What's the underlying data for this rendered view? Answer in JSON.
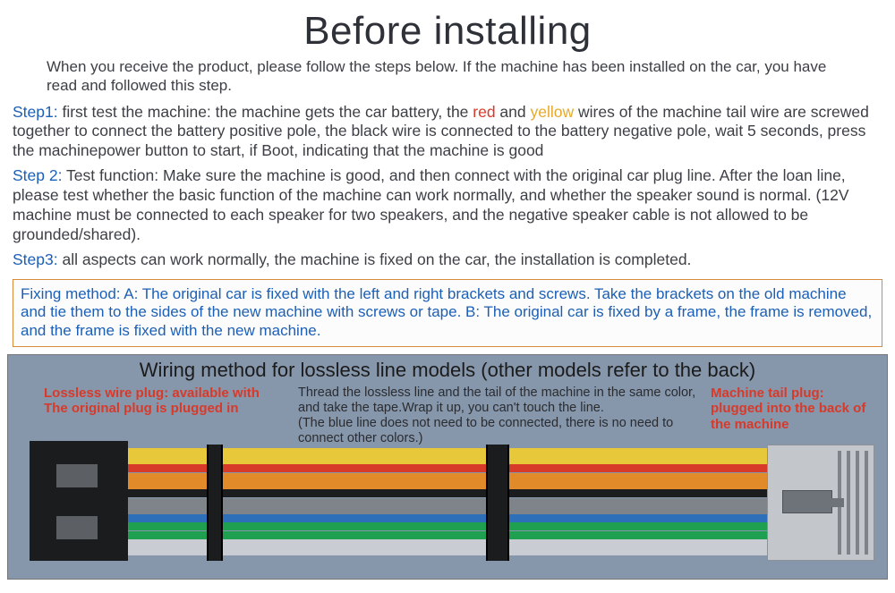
{
  "title": "Before installing",
  "intro": "When you receive the product, please follow the steps below. If the machine has been installed on the car, you have read and followed this step.",
  "step1": {
    "label": "Step1:",
    "pre": " first test the machine: the machine gets the car battery, the ",
    "red": "red",
    "and": " and ",
    "yellow": "yellow",
    "post": " wires of the machine tail wire are screwed together to connect the battery positive pole, the black wire is connected to the battery negative pole, wait 5 seconds, press the machinepower button to start, if Boot, indicating that the machine is good"
  },
  "step2": {
    "label": "Step 2:",
    "text": " Test function: Make sure the machine is good, and then connect with the original car plug line. After the loan line, please test whether the basic function of the machine can work normally, and whether the speaker sound is normal. (12V machine must be connected to each speaker for two speakers, and the negative speaker cable is not allowed to be grounded/shared)."
  },
  "step3": {
    "label": "Step3:",
    "text": " all aspects can work normally, the machine is fixed on the car, the installation is completed."
  },
  "fixing": "Fixing method: A: The original car is fixed with the left and right brackets and screws. Take the brackets on the old machine and tie them to the sides of the new machine with screws or tape. B: The original car is fixed by a frame, the frame is removed, and the frame is fixed with the new machine.",
  "wiring": {
    "title": "Wiring method for lossless line models (other models refer to the back)",
    "left_label": "Lossless wire plug: available with\nThe original plug is plugged in",
    "mid_label": "Thread the lossless line and the tail of the machine in the same color, and take the tape.Wrap it up, you can't touch the line.\n (The blue line does not need to be connected, there is no need to connect other colors.)",
    "right_label": "Machine tail plug: plugged into the back of the machine",
    "wire_colors": [
      "#e7c83a",
      "#e7c83a",
      "#d83a2a",
      "#e08a2a",
      "#e08a2a",
      "#1b1c1e",
      "#7f848a",
      "#7f848a",
      "#2d6fb8",
      "#1fa050",
      "#1fa050",
      "#c9cdd3",
      "#c9cdd3"
    ]
  }
}
